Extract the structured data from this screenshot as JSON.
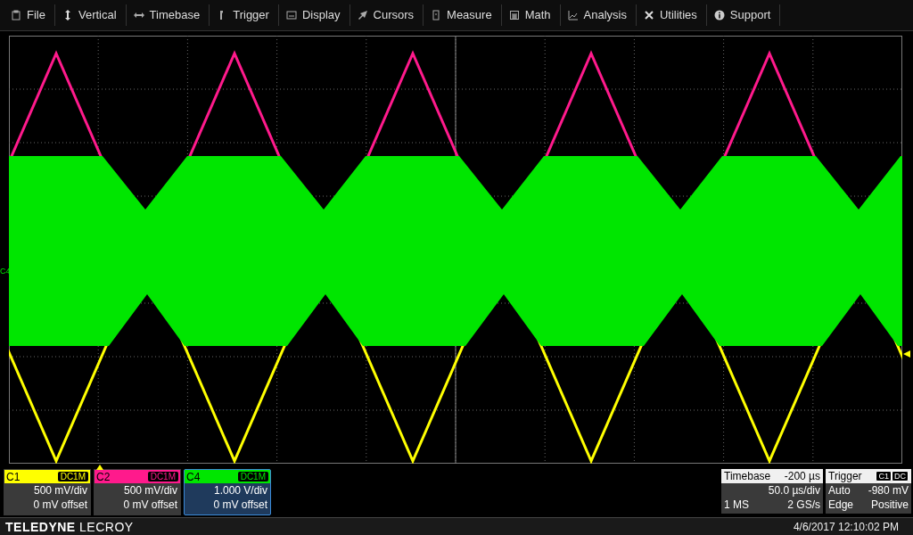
{
  "menu": [
    {
      "label": "File"
    },
    {
      "label": "Vertical"
    },
    {
      "label": "Timebase"
    },
    {
      "label": "Trigger"
    },
    {
      "label": "Display"
    },
    {
      "label": "Cursors"
    },
    {
      "label": "Measure"
    },
    {
      "label": "Math"
    },
    {
      "label": "Analysis"
    },
    {
      "label": "Utilities"
    },
    {
      "label": "Support"
    }
  ],
  "ground_marker": "C4",
  "channels": [
    {
      "name": "C1",
      "coupling": "DC1M",
      "scale": "500 mV/div",
      "offset": "0 mV offset",
      "color": "#ffff00",
      "selected": false
    },
    {
      "name": "C2",
      "coupling": "DC1M",
      "scale": "500 mV/div",
      "offset": "0 mV offset",
      "color": "#ff1a8c",
      "selected": false
    },
    {
      "name": "C4",
      "coupling": "DC1M",
      "scale": "1.000 V/div",
      "offset": "0 mV offset",
      "color": "#00e600",
      "selected": true
    }
  ],
  "timebase": {
    "title": "Timebase",
    "delay": "-200 µs",
    "scale": "50.0 µs/div",
    "samples": "1 MS",
    "rate": "2 GS/s"
  },
  "trigger": {
    "title": "Trigger",
    "source": "C1",
    "coupling": "DC",
    "mode": "Auto",
    "level": "-980 mV",
    "type": "Edge",
    "slope": "Positive"
  },
  "footer": {
    "brand": "**TELEDYNE** LECROY",
    "datetime": "4/6/2017 12:10:02 PM"
  }
}
